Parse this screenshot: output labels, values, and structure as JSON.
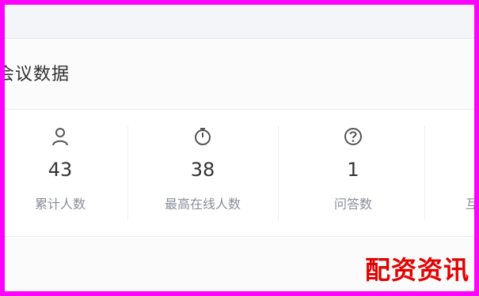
{
  "section": {
    "title": "会议数据"
  },
  "stats": [
    {
      "icon": "user-icon",
      "value": "43",
      "label": "累计人数"
    },
    {
      "icon": "clock-icon",
      "value": "38",
      "label": "最高在线人数"
    },
    {
      "icon": "question-icon",
      "value": "1",
      "label": "问答数"
    }
  ],
  "partial_label": "互",
  "watermark": "配资资讯",
  "colors": {
    "border": "#ff00ff",
    "watermark": "#e30000",
    "text": "#333333",
    "muted": "#8a8f99"
  }
}
